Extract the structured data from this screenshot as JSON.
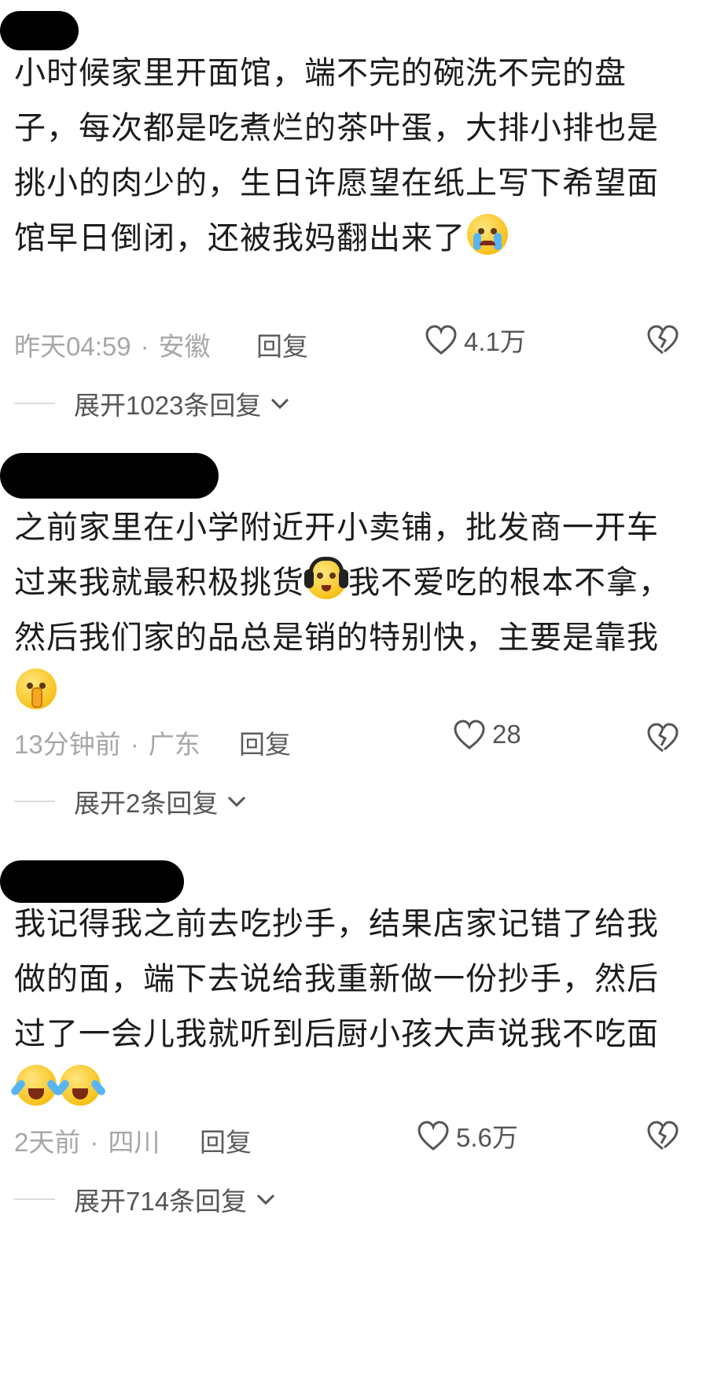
{
  "comments": [
    {
      "text": "小时候家里开面馆，端不完的碗洗不完的盘子，每次都是吃煮烂的茶叶蛋，大排小排也是挑小的肉少的，生日许愿望在纸上写下希望面馆早日倒闭，还被我妈翻出来了",
      "emojis": [
        "loudly-crying-face"
      ],
      "time": "昨天04:59",
      "location": "安徽",
      "reply_label": "回复",
      "likes": "4.1万",
      "expand_label": "展开1023条回复"
    },
    {
      "text_a": "之前家里在小学附近开小卖铺，批发商一开车过来我就最积极挑货",
      "text_b": "我不爱吃的根本不拿，然后我们家的品总是销的特别快，主要是靠我",
      "emojis": [
        "headphones-face",
        "shushing-face"
      ],
      "time": "13分钟前",
      "location": "广东",
      "reply_label": "回复",
      "likes": "28",
      "expand_label": "展开2条回复"
    },
    {
      "text": "我记得我之前去吃抄手，结果店家记错了给我做的面，端下去说给我重新做一份抄手，然后过了一会儿我就听到后厨小孩大声说我不吃面",
      "emojis": [
        "tears-of-joy-face",
        "tears-of-joy-face"
      ],
      "time": "2天前",
      "location": "四川",
      "reply_label": "回复",
      "likes": "5.6万",
      "expand_label": "展开714条回复"
    }
  ],
  "colors": {
    "meta": "#a7a7a7",
    "text": "#1c1c1c",
    "redaction": "#000000"
  }
}
